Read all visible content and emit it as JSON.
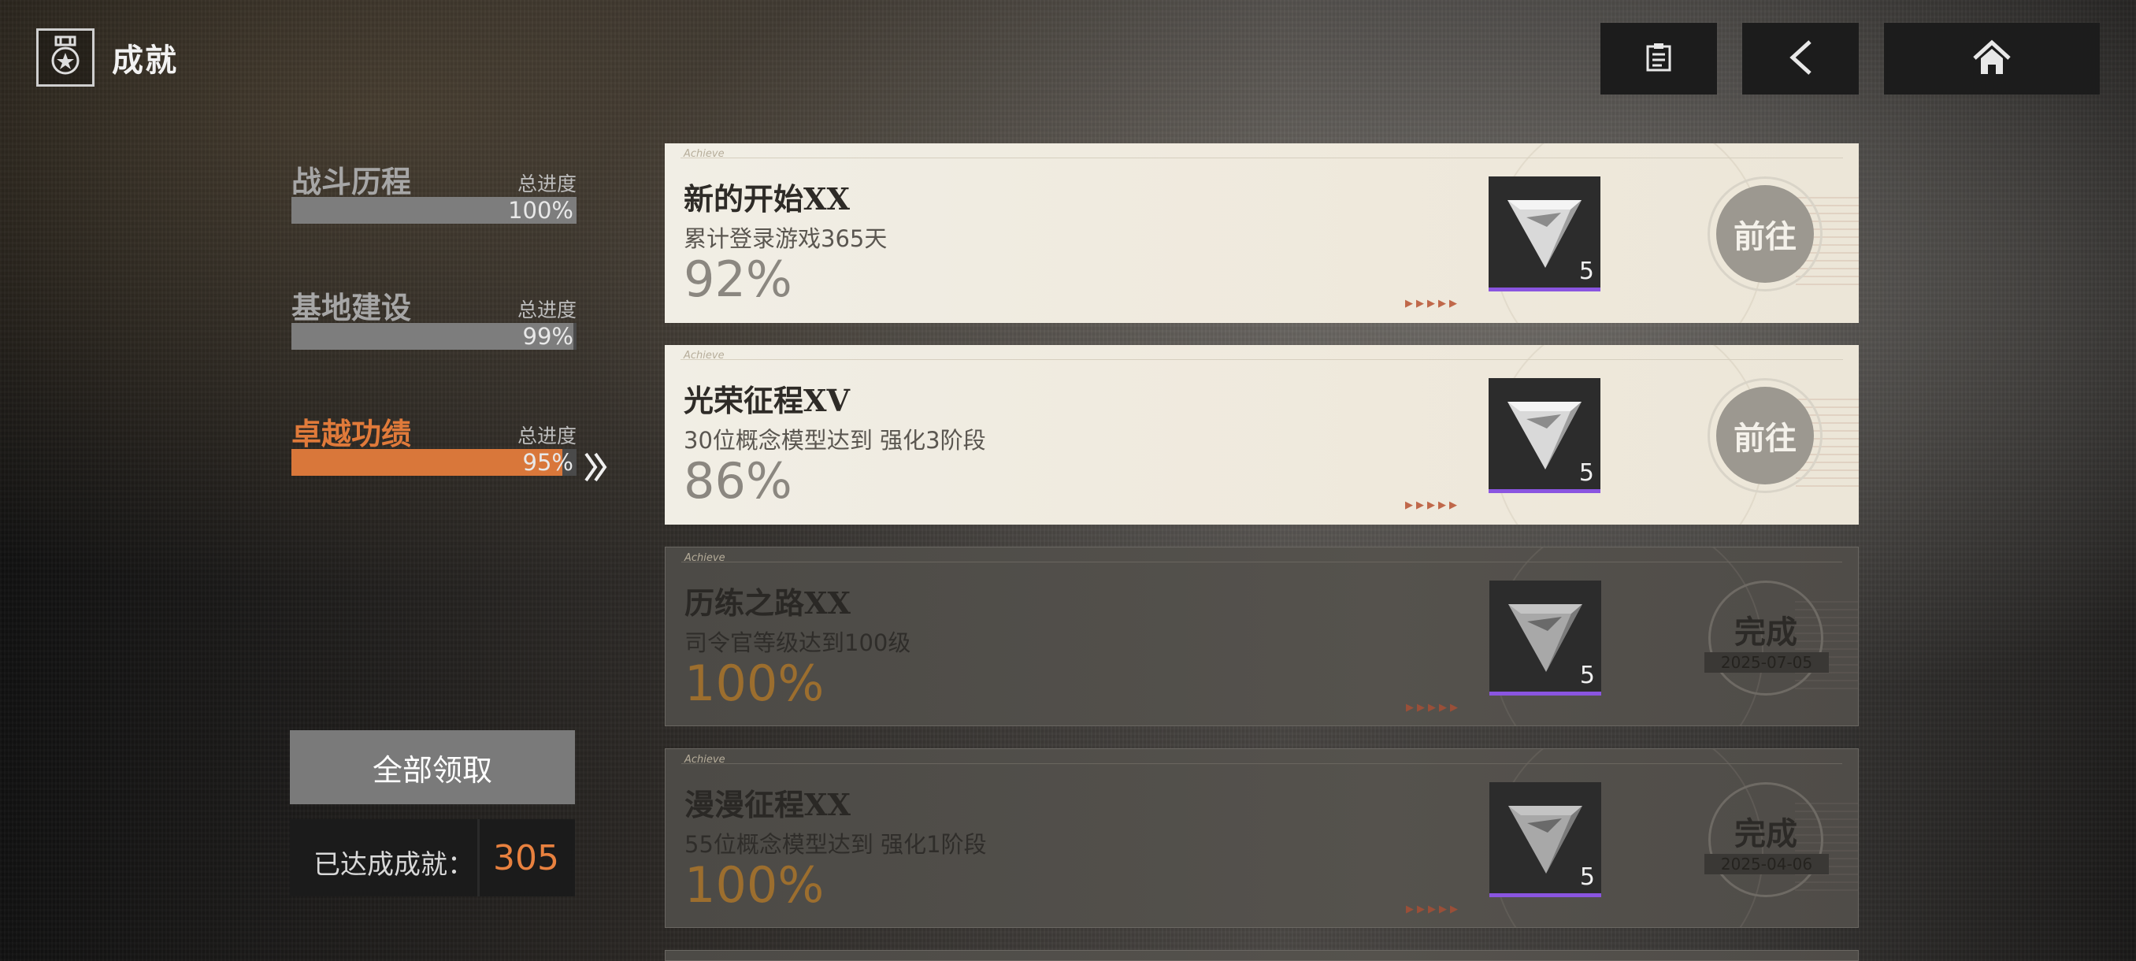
{
  "header": {
    "title": "成就",
    "title_icon": "achievement-medal-icon",
    "buttons": [
      {
        "name": "clipboard-icon"
      },
      {
        "name": "back-arrow-icon"
      },
      {
        "name": "home-icon"
      }
    ]
  },
  "categories": [
    {
      "name": "战斗历程",
      "total_label": "总进度",
      "progress": "100%",
      "progress_value": 100,
      "active": false
    },
    {
      "name": "基地建设",
      "total_label": "总进度",
      "progress": "99%",
      "progress_value": 99,
      "active": false
    },
    {
      "name": "卓越功绩",
      "total_label": "总进度",
      "progress": "95%",
      "progress_value": 95,
      "active": true
    }
  ],
  "sidebar": {
    "claim_all_label": "全部领取",
    "achieved_label": "已达成成就：",
    "achieved_count": "305"
  },
  "cards": [
    {
      "tagline": "Achieve",
      "title": "新的开始XX",
      "desc": "累计登录游戏365天",
      "percent": "92%",
      "reward_count": "5",
      "status": "go",
      "button_label": "前往"
    },
    {
      "tagline": "Achieve",
      "title": "光荣征程XV",
      "desc": "30位概念模型达到 强化3阶段",
      "percent": "86%",
      "reward_count": "5",
      "status": "go",
      "button_label": "前往"
    },
    {
      "tagline": "Achieve",
      "title": "历练之路XX",
      "desc": "司令官等级达到100级",
      "percent": "100%",
      "reward_count": "5",
      "status": "done",
      "button_label": "完成",
      "date": "2025-07-05"
    },
    {
      "tagline": "Achieve",
      "title": "漫漫征程XX",
      "desc": "55位概念模型达到 强化1阶段",
      "percent": "100%",
      "reward_count": "5",
      "status": "done",
      "button_label": "完成",
      "date": "2025-04-06"
    }
  ],
  "colors": {
    "accent": "#d9773a",
    "reward_rarity": "#8a55e0"
  }
}
